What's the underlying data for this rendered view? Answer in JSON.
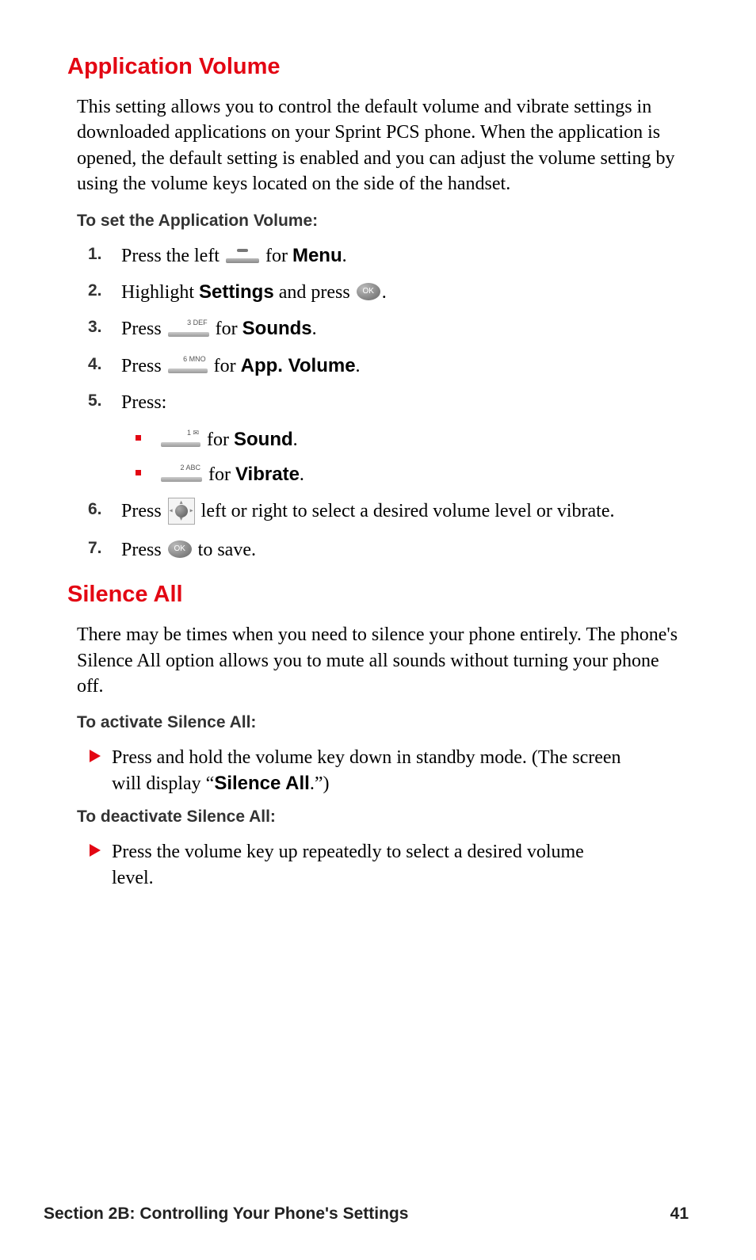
{
  "section1": {
    "heading": "Application Volume",
    "intro": "This setting allows you to control the default volume and vibrate settings in downloaded applications on your Sprint PCS phone. When the application is opened, the default setting is enabled and you can adjust the volume setting by using the volume keys located on the side of the handset.",
    "subhead": "To set the Application Volume:",
    "steps": {
      "s1": {
        "num": "1.",
        "pre": "Press the left ",
        "post": " for ",
        "bold": "Menu",
        "end": "."
      },
      "s2": {
        "num": "2.",
        "pre": "Highlight ",
        "bold": "Settings",
        "mid": " and press ",
        "end": "."
      },
      "s3": {
        "num": "3.",
        "pre": "Press ",
        "post": " for ",
        "bold": "Sounds",
        "end": ".",
        "keylbl": "3 DEF"
      },
      "s4": {
        "num": "4.",
        "pre": "Press ",
        "post": " for ",
        "bold": "App. Volume",
        "end": ".",
        "keylbl": "6 MNO"
      },
      "s5": {
        "num": "5.",
        "text": "Press:",
        "sub1": {
          "post": " for ",
          "bold": "Sound",
          "end": ".",
          "keylbl": "1 ✉"
        },
        "sub2": {
          "post": " for ",
          "bold": "Vibrate",
          "end": ".",
          "keylbl": "2 ABC"
        }
      },
      "s6": {
        "num": "6.",
        "pre": "Press ",
        "post": " left or right to select a desired volume level or vibrate."
      },
      "s7": {
        "num": "7.",
        "pre": "Press ",
        "post": " to save."
      }
    }
  },
  "section2": {
    "heading": "Silence All",
    "intro": "There may be times when you need to silence your phone entirely. The phone's Silence All option allows you to mute all sounds without turning your phone off.",
    "sub1": "To activate Silence All:",
    "item1": {
      "pre": "Press and hold the volume key down in standby mode. (The screen will display “",
      "bold": "Silence All",
      "post": ".”)"
    },
    "sub2": "To deactivate Silence All:",
    "item2": "Press the volume key up repeatedly to select a desired volume level."
  },
  "footer": {
    "section": "Section 2B: Controlling Your Phone's Settings",
    "page": "41"
  },
  "ok_label": "OK"
}
